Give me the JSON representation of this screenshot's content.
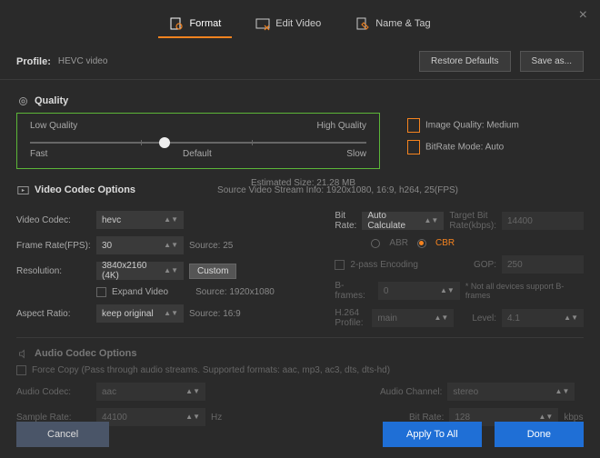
{
  "close_icon": "×",
  "tabs": {
    "format": "Format",
    "edit": "Edit Video",
    "name": "Name & Tag"
  },
  "profile": {
    "label": "Profile:",
    "value": "HEVC video"
  },
  "buttons": {
    "restore": "Restore Defaults",
    "saveas": "Save as...",
    "custom": "Custom",
    "cancel": "Cancel",
    "apply": "Apply To All",
    "done": "Done"
  },
  "estimated": "Estimated Size: 21.28 MB",
  "quality": {
    "title": "Quality",
    "low": "Low Quality",
    "high": "High Quality",
    "fast": "Fast",
    "default": "Default",
    "slow": "Slow",
    "img_q": "Image Quality: Medium",
    "bitrate_mode": "BitRate Mode: Auto"
  },
  "source_info": "Source Video Stream Info: 1920x1080, 16:9, h264, 25(FPS)",
  "vcodec": {
    "title": "Video Codec Options",
    "video_codec_label": "Video Codec:",
    "video_codec": "hevc",
    "fps_label": "Frame Rate(FPS):",
    "fps": "30",
    "fps_src": "Source: 25",
    "res_label": "Resolution:",
    "res": "3840x2160 (4K)",
    "expand": "Expand Video",
    "res_src": "Source: 1920x1080",
    "aspect_label": "Aspect Ratio:",
    "aspect": "keep original",
    "aspect_src": "Source: 16:9",
    "bitrate_label": "Bit Rate:",
    "bitrate": "Auto Calculate",
    "target_label": "Target Bit Rate(kbps):",
    "target": "14400",
    "abr": "ABR",
    "cbr": "CBR",
    "twopass": "2-pass Encoding",
    "gop_label": "GOP:",
    "gop": "250",
    "bframes_label": "B-frames:",
    "bframes": "0",
    "bframes_note": "* Not all devices support B-frames",
    "profile_label": "H.264 Profile:",
    "profile": "main",
    "level_label": "Level:",
    "level": "4.1"
  },
  "acodec": {
    "title": "Audio Codec Options",
    "force": "Force Copy (Pass through audio streams. Supported formats: aac, mp3, ac3, dts, dts-hd)",
    "codec_label": "Audio Codec:",
    "codec": "aac",
    "channel_label": "Audio Channel:",
    "channel": "stereo",
    "sample_label": "Sample Rate:",
    "sample": "44100",
    "hz": "Hz",
    "bitrate_label": "Bit Rate:",
    "bitrate": "128",
    "kbps": "kbps"
  }
}
